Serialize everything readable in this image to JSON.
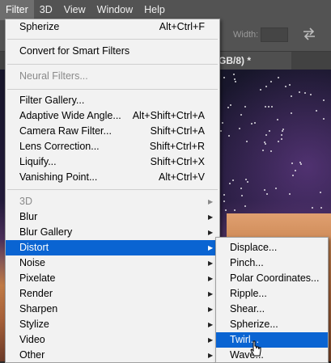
{
  "menubar": {
    "items": [
      {
        "label": "Filter",
        "active": true
      },
      {
        "label": "3D"
      },
      {
        "label": "View"
      },
      {
        "label": "Window"
      },
      {
        "label": "Help"
      }
    ]
  },
  "options_bar": {
    "width_label": "Width:"
  },
  "document_tab": {
    "label": "GB/8) *"
  },
  "filter_menu": {
    "items": [
      {
        "label": "Spherize",
        "shortcut": "Alt+Ctrl+F"
      },
      {
        "label": "Convert for Smart Filters"
      },
      {
        "label": "Neural Filters...",
        "disabled": true
      },
      {
        "label": "Filter Gallery..."
      },
      {
        "label": "Adaptive Wide Angle...",
        "shortcut": "Alt+Shift+Ctrl+A"
      },
      {
        "label": "Camera Raw Filter...",
        "shortcut": "Shift+Ctrl+A"
      },
      {
        "label": "Lens Correction...",
        "shortcut": "Shift+Ctrl+R"
      },
      {
        "label": "Liquify...",
        "shortcut": "Shift+Ctrl+X"
      },
      {
        "label": "Vanishing Point...",
        "shortcut": "Alt+Ctrl+V"
      },
      {
        "label": "3D",
        "disabled": true,
        "submenu": true
      },
      {
        "label": "Blur",
        "submenu": true
      },
      {
        "label": "Blur Gallery",
        "submenu": true
      },
      {
        "label": "Distort",
        "submenu": true,
        "highlighted": true
      },
      {
        "label": "Noise",
        "submenu": true
      },
      {
        "label": "Pixelate",
        "submenu": true
      },
      {
        "label": "Render",
        "submenu": true
      },
      {
        "label": "Sharpen",
        "submenu": true
      },
      {
        "label": "Stylize",
        "submenu": true
      },
      {
        "label": "Video",
        "submenu": true
      },
      {
        "label": "Other",
        "submenu": true
      }
    ]
  },
  "distort_submenu": {
    "items": [
      {
        "label": "Displace..."
      },
      {
        "label": "Pinch..."
      },
      {
        "label": "Polar Coordinates..."
      },
      {
        "label": "Ripple..."
      },
      {
        "label": "Shear..."
      },
      {
        "label": "Spherize..."
      },
      {
        "label": "Twirl...",
        "highlighted": true
      },
      {
        "label": "Wave..."
      }
    ]
  },
  "colors": {
    "highlight": "#0a64d2",
    "menu_bg": "#f2f2f2",
    "app_chrome": "#535353"
  },
  "icons": [
    "swap-arrows-icon",
    "submenu-arrow-icon",
    "mouse-pointer-icon"
  ]
}
